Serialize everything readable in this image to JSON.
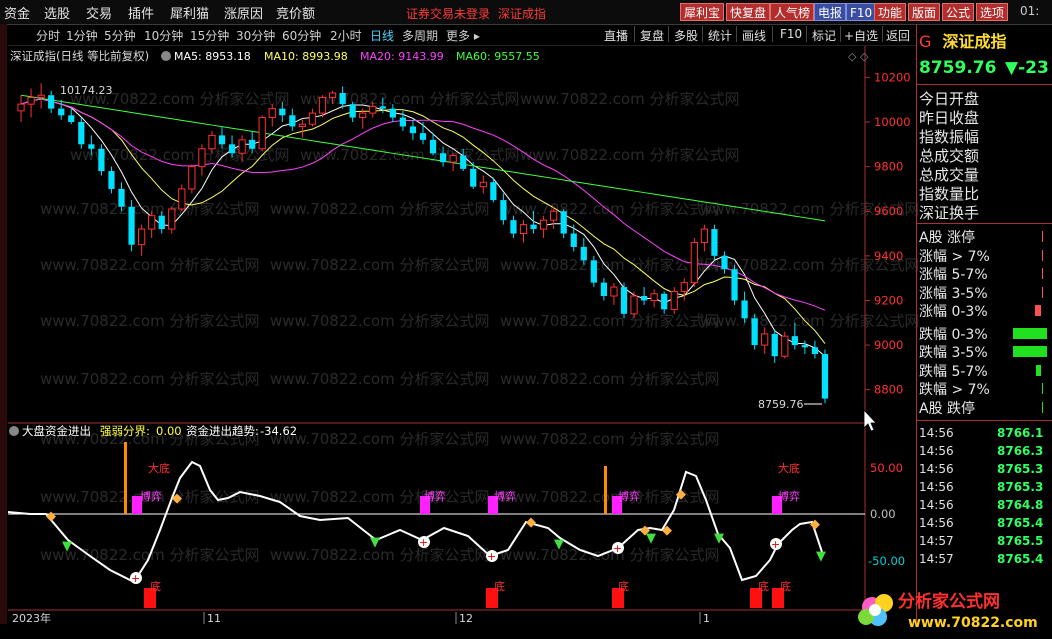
{
  "menu": [
    "资金",
    "选股",
    "交易",
    "插件",
    "犀利猫",
    "涨原因",
    "竞价额"
  ],
  "notices": [
    "证券交易未登录",
    "深证成指"
  ],
  "sys_buttons": [
    {
      "label": "犀利宝",
      "style": "red"
    },
    {
      "label": "快复盘",
      "style": "red"
    },
    {
      "label": "人气榜",
      "style": "red"
    },
    {
      "label": "电报",
      "style": "blue"
    },
    {
      "label": "F10",
      "style": "blue"
    },
    {
      "label": "功能",
      "style": "red"
    },
    {
      "label": "版面",
      "style": "red"
    },
    {
      "label": "公式",
      "style": "red"
    },
    {
      "label": "选项",
      "style": "red"
    }
  ],
  "clock": "01:",
  "periods": [
    {
      "label": "分时",
      "active": false
    },
    {
      "label": "1分钟",
      "active": false
    },
    {
      "label": "5分钟",
      "active": false
    },
    {
      "label": "10分钟",
      "active": false
    },
    {
      "label": "15分钟",
      "active": false
    },
    {
      "label": "30分钟",
      "active": false
    },
    {
      "label": "60分钟",
      "active": false
    },
    {
      "label": "2小时",
      "active": false
    },
    {
      "label": "日线",
      "active": true
    },
    {
      "label": "多周期",
      "active": false
    },
    {
      "label": "更多 ▸",
      "active": false
    }
  ],
  "tools": [
    "直播",
    "复盘",
    "多股",
    "统计",
    "画线",
    "F10",
    "标记",
    "+自选",
    "返回"
  ],
  "main_legend": {
    "title": "深证成指(日线 等比前复权)",
    "ma5": "MA5: 8953.18",
    "ma10": "MA10: 8993.98",
    "ma20": "MA20: 9143.99",
    "ma60": "MA60: 9557.55",
    "high_label": "10174.23",
    "last_label": "8759.76"
  },
  "sub_legend": {
    "title": "大盘资金进出",
    "split_label": "强弱分界:",
    "split_value": "0.00",
    "trend_label": "资金进出趋势:",
    "trend_value": "-34.62"
  },
  "annotations": {
    "big_bottom": "大底",
    "game": "博弈",
    "bottom": "底"
  },
  "price_axis": [
    "10200",
    "10000",
    "9800",
    "9600",
    "9400",
    "9200",
    "9000",
    "8800"
  ],
  "osc_axis": [
    "50.00",
    "0.00",
    "-50.00"
  ],
  "date_labels": [
    "2023年",
    "11",
    "12",
    "1"
  ],
  "watermark": "www.70822.com 分析家公式网",
  "colors": {
    "up": "#ff3030",
    "down": "#00e0ff",
    "ma5": "#ffffff",
    "ma10": "#ffff60",
    "ma20": "#ff40ff",
    "ma60": "#40ff40",
    "border": "#a83030"
  },
  "chart_data": {
    "type": "candlestick",
    "ylim": [
      8700,
      10260
    ],
    "ohlc": [
      [
        10050,
        10120,
        10000,
        10080
      ],
      [
        10080,
        10150,
        10020,
        10110
      ],
      [
        10110,
        10174,
        10060,
        10120
      ],
      [
        10120,
        10140,
        10040,
        10060
      ],
      [
        10060,
        10100,
        10010,
        10030
      ],
      [
        10030,
        10060,
        9990,
        10000
      ],
      [
        10000,
        10020,
        9880,
        9900
      ],
      [
        9900,
        9940,
        9850,
        9880
      ],
      [
        9880,
        9900,
        9760,
        9780
      ],
      [
        9780,
        9800,
        9680,
        9700
      ],
      [
        9700,
        9730,
        9600,
        9620
      ],
      [
        9620,
        9650,
        9420,
        9450
      ],
      [
        9450,
        9540,
        9400,
        9520
      ],
      [
        9520,
        9600,
        9480,
        9580
      ],
      [
        9580,
        9600,
        9500,
        9520
      ],
      [
        9520,
        9620,
        9500,
        9610
      ],
      [
        9610,
        9720,
        9600,
        9700
      ],
      [
        9700,
        9810,
        9680,
        9800
      ],
      [
        9800,
        9900,
        9760,
        9880
      ],
      [
        9880,
        9960,
        9860,
        9940
      ],
      [
        9940,
        9980,
        9880,
        9900
      ],
      [
        9900,
        9940,
        9840,
        9860
      ],
      [
        9860,
        9940,
        9820,
        9920
      ],
      [
        9920,
        9960,
        9860,
        9880
      ],
      [
        9880,
        10030,
        9870,
        10020
      ],
      [
        10020,
        10080,
        9980,
        10060
      ],
      [
        10060,
        10090,
        10000,
        10030
      ],
      [
        10030,
        10060,
        9960,
        9980
      ],
      [
        9980,
        10010,
        9930,
        9990
      ],
      [
        9990,
        10060,
        9980,
        10040
      ],
      [
        10040,
        10120,
        10020,
        10110
      ],
      [
        10110,
        10140,
        10080,
        10130
      ],
      [
        10130,
        10160,
        10060,
        10080
      ],
      [
        10080,
        10090,
        10000,
        10020
      ],
      [
        10020,
        10060,
        9970,
        10040
      ],
      [
        10040,
        10090,
        10020,
        10070
      ],
      [
        10070,
        10110,
        10040,
        10060
      ],
      [
        10060,
        10080,
        10000,
        10020
      ],
      [
        10020,
        10050,
        9960,
        9980
      ],
      [
        9980,
        10010,
        9920,
        9950
      ],
      [
        9950,
        10000,
        9900,
        9920
      ],
      [
        9920,
        9950,
        9850,
        9860
      ],
      [
        9860,
        9890,
        9800,
        9820
      ],
      [
        9820,
        9860,
        9780,
        9850
      ],
      [
        9850,
        9880,
        9780,
        9790
      ],
      [
        9790,
        9820,
        9700,
        9710
      ],
      [
        9710,
        9760,
        9680,
        9730
      ],
      [
        9730,
        9750,
        9640,
        9650
      ],
      [
        9650,
        9680,
        9540,
        9560
      ],
      [
        9560,
        9580,
        9480,
        9500
      ],
      [
        9500,
        9560,
        9460,
        9540
      ],
      [
        9540,
        9600,
        9500,
        9520
      ],
      [
        9520,
        9580,
        9480,
        9560
      ],
      [
        9560,
        9620,
        9520,
        9600
      ],
      [
        9600,
        9610,
        9480,
        9500
      ],
      [
        9500,
        9540,
        9420,
        9440
      ],
      [
        9440,
        9480,
        9360,
        9380
      ],
      [
        9380,
        9400,
        9260,
        9280
      ],
      [
        9280,
        9300,
        9200,
        9220
      ],
      [
        9220,
        9280,
        9180,
        9260
      ],
      [
        9260,
        9280,
        9120,
        9140
      ],
      [
        9140,
        9240,
        9120,
        9220
      ],
      [
        9220,
        9260,
        9180,
        9200
      ],
      [
        9200,
        9250,
        9170,
        9230
      ],
      [
        9230,
        9240,
        9140,
        9160
      ],
      [
        9160,
        9260,
        9140,
        9240
      ],
      [
        9240,
        9300,
        9200,
        9280
      ],
      [
        9280,
        9480,
        9260,
        9460
      ],
      [
        9460,
        9540,
        9420,
        9520
      ],
      [
        9520,
        9540,
        9380,
        9400
      ],
      [
        9400,
        9420,
        9320,
        9340
      ],
      [
        9340,
        9360,
        9180,
        9200
      ],
      [
        9200,
        9240,
        9100,
        9120
      ],
      [
        9120,
        9140,
        8980,
        9000
      ],
      [
        9000,
        9080,
        8960,
        9050
      ],
      [
        9050,
        9070,
        8920,
        8950
      ],
      [
        8950,
        9060,
        8940,
        9040
      ],
      [
        9040,
        9100,
        8980,
        9000
      ],
      [
        9000,
        9020,
        8960,
        8990
      ],
      [
        8990,
        9020,
        8940,
        8960
      ],
      [
        8960,
        8980,
        8740,
        8760
      ]
    ]
  }
}
